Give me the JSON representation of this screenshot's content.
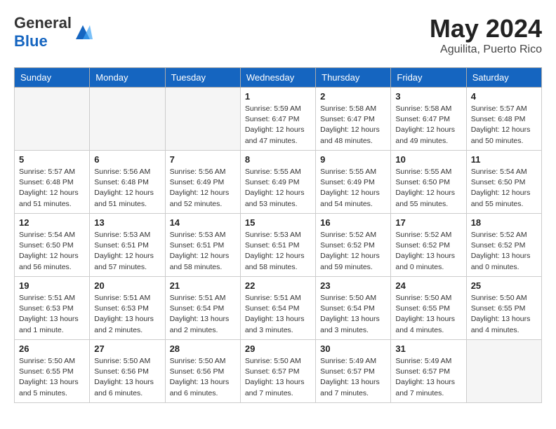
{
  "header": {
    "logo_general": "General",
    "logo_blue": "Blue",
    "month_year": "May 2024",
    "location": "Aguilita, Puerto Rico"
  },
  "weekdays": [
    "Sunday",
    "Monday",
    "Tuesday",
    "Wednesday",
    "Thursday",
    "Friday",
    "Saturday"
  ],
  "weeks": [
    [
      {
        "day": "",
        "info": ""
      },
      {
        "day": "",
        "info": ""
      },
      {
        "day": "",
        "info": ""
      },
      {
        "day": "1",
        "info": "Sunrise: 5:59 AM\nSunset: 6:47 PM\nDaylight: 12 hours\nand 47 minutes."
      },
      {
        "day": "2",
        "info": "Sunrise: 5:58 AM\nSunset: 6:47 PM\nDaylight: 12 hours\nand 48 minutes."
      },
      {
        "day": "3",
        "info": "Sunrise: 5:58 AM\nSunset: 6:47 PM\nDaylight: 12 hours\nand 49 minutes."
      },
      {
        "day": "4",
        "info": "Sunrise: 5:57 AM\nSunset: 6:48 PM\nDaylight: 12 hours\nand 50 minutes."
      }
    ],
    [
      {
        "day": "5",
        "info": "Sunrise: 5:57 AM\nSunset: 6:48 PM\nDaylight: 12 hours\nand 51 minutes."
      },
      {
        "day": "6",
        "info": "Sunrise: 5:56 AM\nSunset: 6:48 PM\nDaylight: 12 hours\nand 51 minutes."
      },
      {
        "day": "7",
        "info": "Sunrise: 5:56 AM\nSunset: 6:49 PM\nDaylight: 12 hours\nand 52 minutes."
      },
      {
        "day": "8",
        "info": "Sunrise: 5:55 AM\nSunset: 6:49 PM\nDaylight: 12 hours\nand 53 minutes."
      },
      {
        "day": "9",
        "info": "Sunrise: 5:55 AM\nSunset: 6:49 PM\nDaylight: 12 hours\nand 54 minutes."
      },
      {
        "day": "10",
        "info": "Sunrise: 5:55 AM\nSunset: 6:50 PM\nDaylight: 12 hours\nand 55 minutes."
      },
      {
        "day": "11",
        "info": "Sunrise: 5:54 AM\nSunset: 6:50 PM\nDaylight: 12 hours\nand 55 minutes."
      }
    ],
    [
      {
        "day": "12",
        "info": "Sunrise: 5:54 AM\nSunset: 6:50 PM\nDaylight: 12 hours\nand 56 minutes."
      },
      {
        "day": "13",
        "info": "Sunrise: 5:53 AM\nSunset: 6:51 PM\nDaylight: 12 hours\nand 57 minutes."
      },
      {
        "day": "14",
        "info": "Sunrise: 5:53 AM\nSunset: 6:51 PM\nDaylight: 12 hours\nand 58 minutes."
      },
      {
        "day": "15",
        "info": "Sunrise: 5:53 AM\nSunset: 6:51 PM\nDaylight: 12 hours\nand 58 minutes."
      },
      {
        "day": "16",
        "info": "Sunrise: 5:52 AM\nSunset: 6:52 PM\nDaylight: 12 hours\nand 59 minutes."
      },
      {
        "day": "17",
        "info": "Sunrise: 5:52 AM\nSunset: 6:52 PM\nDaylight: 13 hours\nand 0 minutes."
      },
      {
        "day": "18",
        "info": "Sunrise: 5:52 AM\nSunset: 6:52 PM\nDaylight: 13 hours\nand 0 minutes."
      }
    ],
    [
      {
        "day": "19",
        "info": "Sunrise: 5:51 AM\nSunset: 6:53 PM\nDaylight: 13 hours\nand 1 minute."
      },
      {
        "day": "20",
        "info": "Sunrise: 5:51 AM\nSunset: 6:53 PM\nDaylight: 13 hours\nand 2 minutes."
      },
      {
        "day": "21",
        "info": "Sunrise: 5:51 AM\nSunset: 6:54 PM\nDaylight: 13 hours\nand 2 minutes."
      },
      {
        "day": "22",
        "info": "Sunrise: 5:51 AM\nSunset: 6:54 PM\nDaylight: 13 hours\nand 3 minutes."
      },
      {
        "day": "23",
        "info": "Sunrise: 5:50 AM\nSunset: 6:54 PM\nDaylight: 13 hours\nand 3 minutes."
      },
      {
        "day": "24",
        "info": "Sunrise: 5:50 AM\nSunset: 6:55 PM\nDaylight: 13 hours\nand 4 minutes."
      },
      {
        "day": "25",
        "info": "Sunrise: 5:50 AM\nSunset: 6:55 PM\nDaylight: 13 hours\nand 4 minutes."
      }
    ],
    [
      {
        "day": "26",
        "info": "Sunrise: 5:50 AM\nSunset: 6:55 PM\nDaylight: 13 hours\nand 5 minutes."
      },
      {
        "day": "27",
        "info": "Sunrise: 5:50 AM\nSunset: 6:56 PM\nDaylight: 13 hours\nand 6 minutes."
      },
      {
        "day": "28",
        "info": "Sunrise: 5:50 AM\nSunset: 6:56 PM\nDaylight: 13 hours\nand 6 minutes."
      },
      {
        "day": "29",
        "info": "Sunrise: 5:50 AM\nSunset: 6:57 PM\nDaylight: 13 hours\nand 7 minutes."
      },
      {
        "day": "30",
        "info": "Sunrise: 5:49 AM\nSunset: 6:57 PM\nDaylight: 13 hours\nand 7 minutes."
      },
      {
        "day": "31",
        "info": "Sunrise: 5:49 AM\nSunset: 6:57 PM\nDaylight: 13 hours\nand 7 minutes."
      },
      {
        "day": "",
        "info": ""
      }
    ]
  ]
}
